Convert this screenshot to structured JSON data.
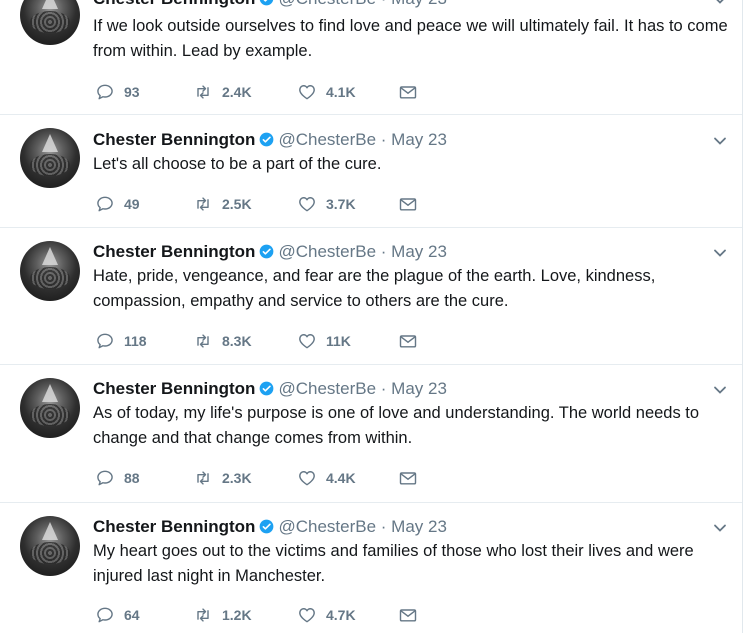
{
  "author": {
    "name": "Chester Bennington",
    "handle": "@ChesterBe",
    "separator": "·"
  },
  "colors": {
    "verified": "#1da1f2",
    "meta": "#657786",
    "text": "#14171a"
  },
  "tweets": [
    {
      "date": "May 23",
      "text": "If we look outside ourselves to find love and peace we will ultimately fail. It has to come from within. Lead by example.",
      "replies": "93",
      "retweets": "2.4K",
      "likes": "4.1K"
    },
    {
      "date": "May 23",
      "text": "Let's all choose to be a part of the cure.",
      "replies": "49",
      "retweets": "2.5K",
      "likes": "3.7K"
    },
    {
      "date": "May 23",
      "text": "Hate, pride, vengeance, and fear are the plague of the earth. Love, kindness, compassion, empathy and service to others are the cure.",
      "replies": "118",
      "retweets": "8.3K",
      "likes": "11K"
    },
    {
      "date": "May 23",
      "text": "As of today, my life's purpose is one of love and understanding. The world needs to change and that change comes from within.",
      "replies": "88",
      "retweets": "2.3K",
      "likes": "4.4K"
    },
    {
      "date": "May 23",
      "text": "My heart goes out to the victims and families of those who lost their lives and were injured last night in Manchester.",
      "replies": "64",
      "retweets": "1.2K",
      "likes": "4.7K"
    }
  ]
}
